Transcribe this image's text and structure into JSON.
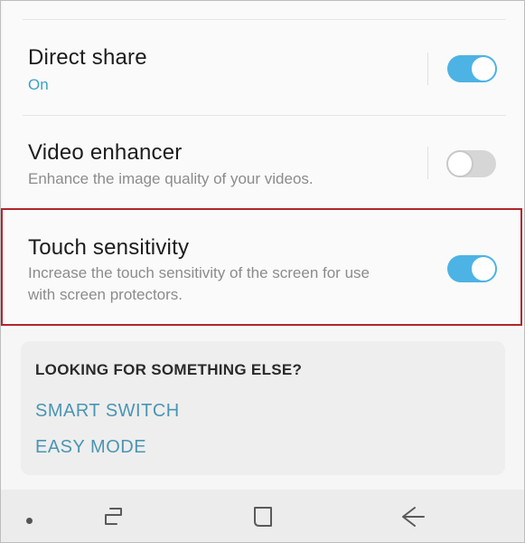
{
  "settings": [
    {
      "title": "Direct share",
      "subtitle": "On",
      "toggle": "on"
    },
    {
      "title": "Video enhancer",
      "subtitle": "Enhance the image quality of your videos.",
      "toggle": "off"
    },
    {
      "title": "Touch sensitivity",
      "subtitle_line1": "Increase the touch sensitivity of the screen for use",
      "subtitle_line2": "with screen protectors.",
      "toggle": "on"
    }
  ],
  "suggestions": {
    "heading": "LOOKING FOR SOMETHING ELSE?",
    "links": [
      "SMART SWITCH",
      "EASY MODE"
    ]
  },
  "navbar": {
    "buttons": [
      "recent-apps-icon",
      "home-icon",
      "back-icon"
    ]
  },
  "colors": {
    "accent": "#4cb3e4",
    "link": "#4a95b3",
    "highlight": "#b0262b"
  }
}
